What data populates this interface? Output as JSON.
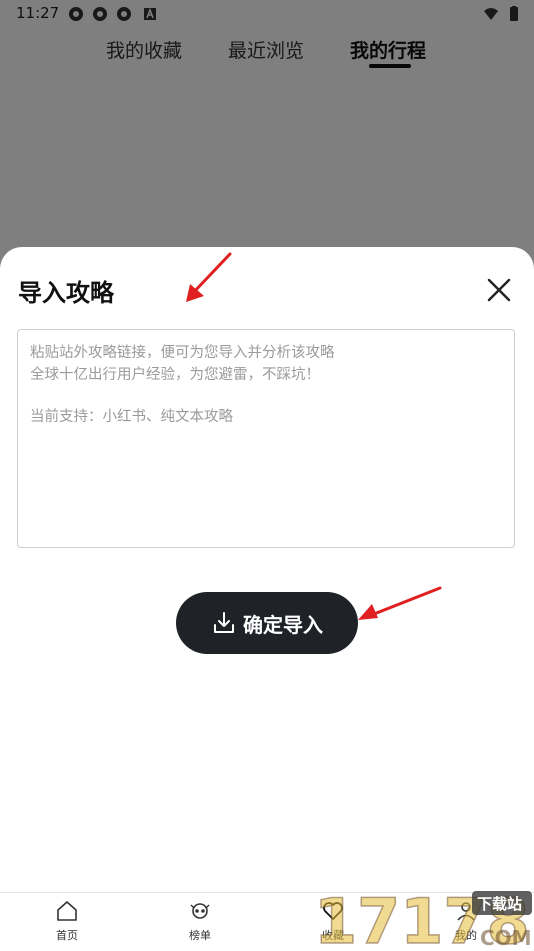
{
  "status_bar": {
    "time": "11:27"
  },
  "top_tabs": [
    {
      "label": "我的收藏"
    },
    {
      "label": "最近浏览"
    },
    {
      "label": "我的行程",
      "active": true
    }
  ],
  "import_sheet": {
    "title": "导入攻略",
    "placeholder_lines": [
      "粘贴站外攻略链接，便可为您导入并分析该攻略",
      "全球十亿出行用户经验，为您避雷，不踩坑！",
      "当前支持：小红书、纯文本攻略"
    ],
    "confirm_label": "确定导入"
  },
  "bottom_nav": [
    {
      "label": "首页",
      "icon": "home-icon"
    },
    {
      "label": "榜单",
      "icon": "ranking-icon"
    },
    {
      "label": "收藏",
      "icon": "heart-icon"
    },
    {
      "label": "我的",
      "icon": "user-icon"
    }
  ],
  "watermark": {
    "text": "17178",
    "tag": "下载站",
    "suffix": "COM"
  },
  "colors": {
    "button_bg": "#1f2328",
    "annotation_arrow": "#e02020",
    "overlay": "rgba(0,0,0,0.5)"
  }
}
